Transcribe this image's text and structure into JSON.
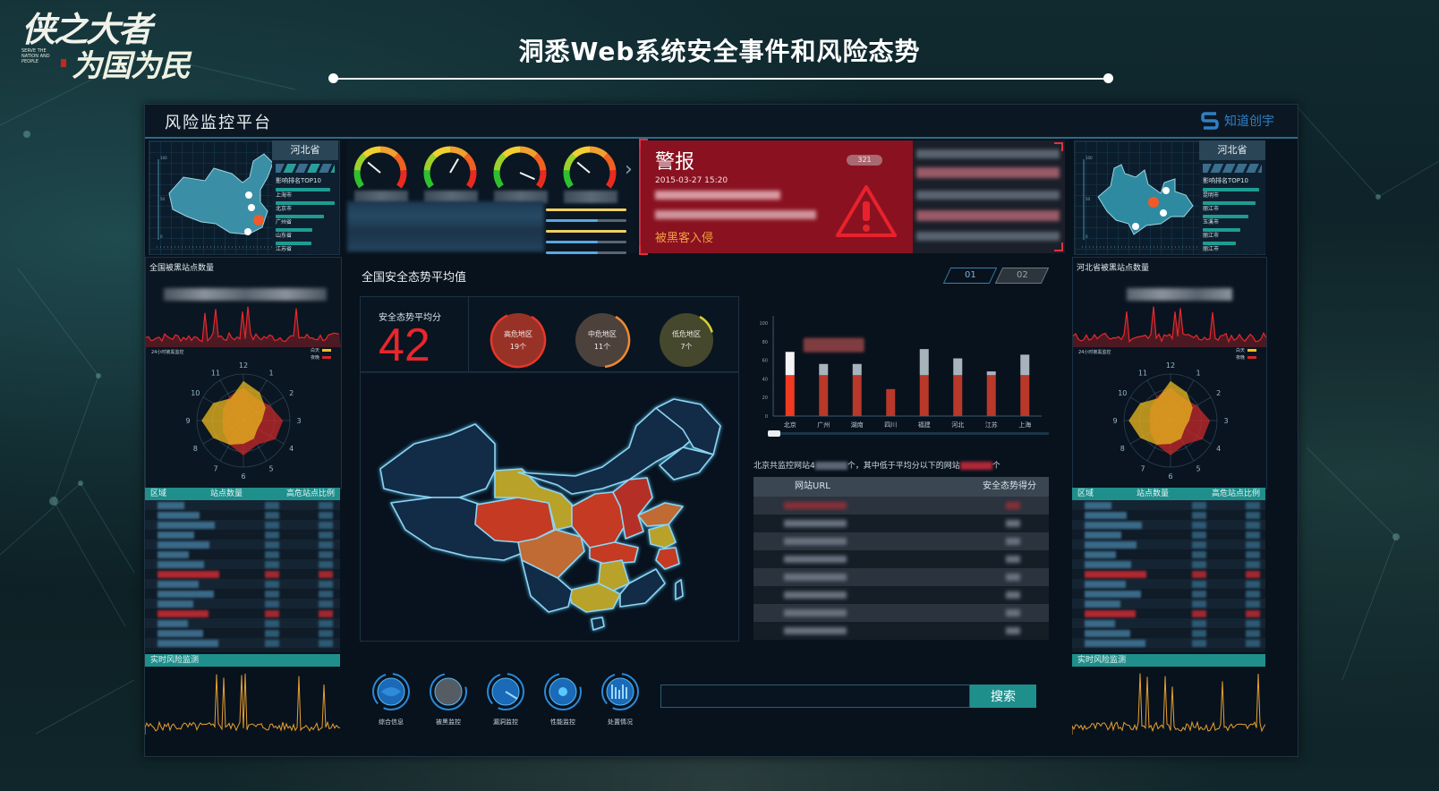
{
  "slide": {
    "title": "洞悉Web系统安全事件和风险态势",
    "logo_line1": "侠之大者",
    "logo_line2": "为国为民",
    "logo_english": "SERVE THE NATION AND PEOPLE"
  },
  "dashboard": {
    "title": "风险监控平台",
    "brand": "知道创宇",
    "colors": {
      "accent_teal": "#1f8f8c",
      "alert_red": "#8a1220",
      "danger": "#e8262c",
      "warning_orange": "#e07a2c",
      "low_yellow": "#d8c22a"
    }
  },
  "left_top": {
    "province": "河北省",
    "ranking_title": "影响排名TOP10",
    "ranking": [
      {
        "name": "上海市",
        "share": 0.92
      },
      {
        "name": "北京市",
        "share": 1.0
      },
      {
        "name": "广州省",
        "share": 0.82
      },
      {
        "name": "山东省",
        "share": 0.62
      },
      {
        "name": "江苏省",
        "share": 0.6
      }
    ],
    "map_axis_ticks": [
      "100",
      "50",
      "0"
    ]
  },
  "right_top": {
    "province": "河北省",
    "ranking_title": "影响排名TOP10",
    "ranking": [
      {
        "name": "昆明市",
        "share": 0.95
      },
      {
        "name": "丽江市",
        "share": 0.9
      },
      {
        "name": "玉溪市",
        "share": 0.78
      },
      {
        "name": "丽江市",
        "share": 0.64
      },
      {
        "name": "丽江市",
        "share": 0.56
      }
    ],
    "map_axis_ticks": [
      "100",
      "50",
      "0"
    ]
  },
  "gauges": [
    {
      "value": 0.3
    },
    {
      "value": 0.62
    },
    {
      "value": 0.95
    },
    {
      "value": 0.3
    }
  ],
  "progress_bars": [
    {
      "value": 1.0,
      "color": "#f0d060"
    },
    {
      "value": 0.64,
      "color": "#5aa8e0"
    },
    {
      "value": 1.0,
      "color": "#f0d060"
    },
    {
      "value": 0.64,
      "color": "#5aa8e0"
    },
    {
      "value": 0.64,
      "color": "#5aa8e0"
    }
  ],
  "alert": {
    "title": "警报",
    "badge": "321",
    "time": "2015-03-27 15:20",
    "type": "被黑客入侵"
  },
  "left_panel": {
    "hacked_title": "全国被黑站点数量",
    "monitor_label": "24小时被黑监控",
    "legend": [
      {
        "label": "白天",
        "color": "#f0c020"
      },
      {
        "label": "夜晚",
        "color": "#d02828"
      }
    ],
    "radar_labels": [
      "12",
      "1",
      "2",
      "3",
      "4",
      "5",
      "6",
      "7",
      "8",
      "9",
      "10",
      "11"
    ],
    "radar_day": [
      0.85,
      0.7,
      0.55,
      0.4,
      0.35,
      0.45,
      0.5,
      0.6,
      0.75,
      0.9,
      0.75,
      0.55
    ],
    "radar_night": [
      0.7,
      0.55,
      0.65,
      0.85,
      0.8,
      0.6,
      0.75,
      0.6,
      0.5,
      0.45,
      0.5,
      0.6
    ],
    "table_headers": [
      "区域",
      "站点数量",
      "高危站点比例"
    ],
    "realtime_title": "实时风险监测"
  },
  "right_panel": {
    "hacked_title": "河北省被黑站点数量",
    "monitor_label": "24小时被黑监控",
    "legend": [
      {
        "label": "白天",
        "color": "#f0c020"
      },
      {
        "label": "夜晚",
        "color": "#d02828"
      }
    ],
    "radar_labels": [
      "12",
      "1",
      "2",
      "3",
      "4",
      "5",
      "6",
      "7",
      "8",
      "9",
      "10",
      "11"
    ],
    "radar_day": [
      0.85,
      0.7,
      0.55,
      0.4,
      0.35,
      0.45,
      0.5,
      0.6,
      0.75,
      0.9,
      0.75,
      0.55
    ],
    "radar_night": [
      0.7,
      0.55,
      0.65,
      0.85,
      0.8,
      0.6,
      0.75,
      0.6,
      0.5,
      0.45,
      0.5,
      0.6
    ],
    "table_headers": [
      "区域",
      "站点数量",
      "高危站点比例"
    ],
    "realtime_title": "实时风险监测"
  },
  "center": {
    "title": "全国安全态势平均值",
    "score_label": "安全态势平均分",
    "score": "42",
    "risk_regions": [
      {
        "label": "高危地区",
        "count": "19个",
        "color": "#e8362a",
        "fill": "rgba(200,60,40,0.75)",
        "ring": 0.85
      },
      {
        "label": "中危地区",
        "count": "11个",
        "color": "#f08a30",
        "fill": "rgba(100,80,70,0.75)",
        "ring": 0.4
      },
      {
        "label": "低危地区",
        "count": "7个",
        "color": "#d8d030",
        "fill": "rgba(90,90,50,0.75)",
        "ring": 0.12
      }
    ],
    "tabs": [
      "01",
      "02"
    ]
  },
  "chart_data": {
    "type": "bar",
    "title": "",
    "categories": [
      "北京",
      "广州",
      "湖南",
      "四川",
      "福建",
      "河北",
      "江苏",
      "上海"
    ],
    "series": [
      {
        "name": "base",
        "values": [
          44,
          44,
          44,
          29,
          44,
          44,
          44,
          44
        ]
      },
      {
        "name": "extra",
        "values": [
          25,
          12,
          12,
          0,
          28,
          18,
          4,
          22
        ]
      }
    ],
    "yticks": [
      "0",
      "20",
      "40",
      "60",
      "80",
      "100"
    ],
    "ylim": [
      0,
      100
    ],
    "xlabel": "",
    "ylabel": "",
    "grid": false
  },
  "url_table": {
    "summary_prefix": "北京共监控网站4",
    "summary_mid": "个，其中低于平均分以下的网站",
    "summary_suffix": "个",
    "headers": [
      "网站URL",
      "安全态势得分"
    ],
    "row_count": 8
  },
  "bottom_nav": [
    {
      "label": "综合信息",
      "icon": "overview"
    },
    {
      "label": "被黑监控",
      "icon": "hack-monitor"
    },
    {
      "label": "漏洞监控",
      "icon": "vuln-monitor"
    },
    {
      "label": "性能监控",
      "icon": "perf-monitor"
    },
    {
      "label": "处置情况",
      "icon": "disposal"
    }
  ],
  "search": {
    "value": "",
    "placeholder": "",
    "button": "搜索"
  }
}
